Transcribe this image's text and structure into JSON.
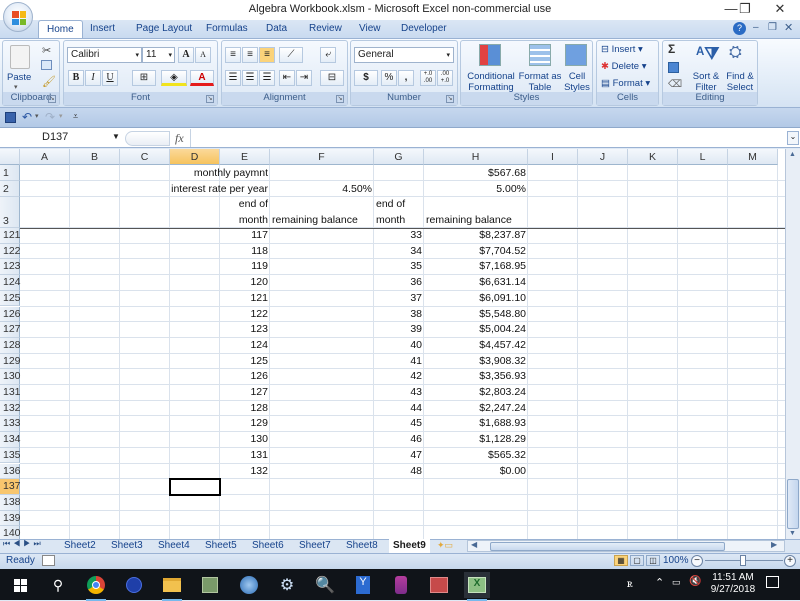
{
  "window": {
    "title": "Algebra Workbook.xlsm - Microsoft Excel non-commercial use",
    "controls": {
      "minimize": "—",
      "restore": "❐",
      "close": "✕"
    }
  },
  "ribbon": {
    "tabs": [
      {
        "label": "Home",
        "active": true
      },
      {
        "label": "Insert"
      },
      {
        "label": "Page Layout"
      },
      {
        "label": "Formulas"
      },
      {
        "label": "Data"
      },
      {
        "label": "Review"
      },
      {
        "label": "View"
      },
      {
        "label": "Developer"
      }
    ],
    "clipboard": {
      "paste": "Paste",
      "group": "Clipboard"
    },
    "font": {
      "name": "Calibri",
      "size": "11",
      "group": "Font",
      "bold": "B",
      "italic": "I",
      "underline": "U",
      "grow": "A",
      "shrink": "A",
      "font_color": "A"
    },
    "alignment": {
      "group": "Alignment"
    },
    "number": {
      "format": "General",
      "currency": "$",
      "percent": "%",
      "comma": ",",
      "inc_decimal": "+.0 .00",
      "dec_decimal": ".00 +.0",
      "group": "Number"
    },
    "styles": {
      "conditional_formatting": "Conditional Formatting",
      "format_as_table": "Format as Table",
      "cell_styles": "Cell Styles",
      "group": "Styles"
    },
    "cells": {
      "insert": "Insert",
      "delete": "Delete",
      "format": "Format",
      "group": "Cells"
    },
    "editing": {
      "sum": "Σ",
      "sort_filter": "Sort & Filter",
      "find_select": "Find & Select",
      "group": "Editing"
    }
  },
  "formula_bar": {
    "name_box": "D137",
    "fx": "fx",
    "formula": ""
  },
  "grid": {
    "columns": [
      "A",
      "B",
      "C",
      "D",
      "E",
      "F",
      "G",
      "H",
      "I",
      "J",
      "K",
      "L",
      "M"
    ],
    "selected_column": "D",
    "selected_cell": "D137",
    "header_rows": {
      "r1": {
        "row": "1",
        "D_label": "monthly paymnt",
        "H": "$567.68"
      },
      "r2": {
        "row": "2",
        "D_label": "interest rate per year",
        "F": "4.50%",
        "H": "5.00%"
      },
      "r3": {
        "row": "3",
        "E_top": "end of",
        "E_bottom": "month",
        "F": "remaining balance",
        "G_top": "end of",
        "G_bottom": "month",
        "H": "remaining balance"
      }
    },
    "rows": [
      {
        "row": "121",
        "E": "117",
        "G": "33",
        "H": "$8,237.87"
      },
      {
        "row": "122",
        "E": "118",
        "G": "34",
        "H": "$7,704.52"
      },
      {
        "row": "123",
        "E": "119",
        "G": "35",
        "H": "$7,168.95"
      },
      {
        "row": "124",
        "E": "120",
        "G": "36",
        "H": "$6,631.14"
      },
      {
        "row": "125",
        "E": "121",
        "G": "37",
        "H": "$6,091.10"
      },
      {
        "row": "126",
        "E": "122",
        "G": "38",
        "H": "$5,548.80"
      },
      {
        "row": "127",
        "E": "123",
        "G": "39",
        "H": "$5,004.24"
      },
      {
        "row": "128",
        "E": "124",
        "G": "40",
        "H": "$4,457.42"
      },
      {
        "row": "129",
        "E": "125",
        "G": "41",
        "H": "$3,908.32"
      },
      {
        "row": "130",
        "E": "126",
        "G": "42",
        "H": "$3,356.93"
      },
      {
        "row": "131",
        "E": "127",
        "G": "43",
        "H": "$2,803.24"
      },
      {
        "row": "132",
        "E": "128",
        "G": "44",
        "H": "$2,247.24"
      },
      {
        "row": "133",
        "E": "129",
        "G": "45",
        "H": "$1,688.93"
      },
      {
        "row": "134",
        "E": "130",
        "G": "46",
        "H": "$1,128.29"
      },
      {
        "row": "135",
        "E": "131",
        "G": "47",
        "H": "$565.32"
      },
      {
        "row": "136",
        "E": "132",
        "G": "48",
        "H": "$0.00"
      },
      {
        "row": "137"
      },
      {
        "row": "138"
      },
      {
        "row": "139"
      },
      {
        "row": "140"
      }
    ]
  },
  "sheets": [
    "Sheet2",
    "Sheet3",
    "Sheet4",
    "Sheet5",
    "Sheet6",
    "Sheet7",
    "Sheet8",
    "Sheet9"
  ],
  "active_sheet": "Sheet9",
  "status": {
    "text": "Ready",
    "zoom": "100%",
    "zoom_minus": "−",
    "zoom_plus": "+"
  },
  "taskbar": {
    "time": "11:51 AM",
    "date": "9/27/2018",
    "apps": [
      "start",
      "search",
      "chrome",
      "app-blue",
      "file-explorer",
      "app-green",
      "thunderbird",
      "app-gear",
      "magnifier",
      "app-blue-box",
      "app-stack",
      "app-red",
      "excel"
    ]
  }
}
